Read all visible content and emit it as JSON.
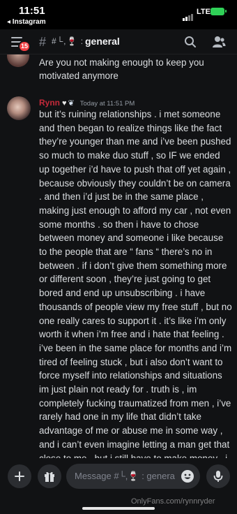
{
  "status_bar": {
    "time": "11:51",
    "back_app": "◂ Instagram",
    "network": "LTE"
  },
  "header": {
    "unread_badge": "15",
    "channel_icons": "#└,🍷 :",
    "channel_name": "general"
  },
  "messages": [
    {
      "text": "Are you not making enough to keep you motivated anymore"
    },
    {
      "author": "Rynn",
      "author_color": "#c4293a",
      "timestamp": "Today at 11:51 PM",
      "text": "but it’s ruining relationships . i met someone and then began to realize things like the fact they’re younger than me and i’ve been pushed so much to make duo stuff , so IF we ended up together i’d have to push that off yet again , because obviously they couldn’t be on camera . and then i’d just be in the same place , making just enough to afford my car , not even some months . so then i have to chose between money and someone i like because to the people that are “ fans “ there’s no in between . if i don’t give them something more or different soon , they’re just going to get bored and end up unsubscribing . i have thousands of people view my free stuff , but no one really cares to support it . it’s like i’m only worth it when i’m free and i hate that feeling . i’ve been in the same place for months and i’m tired of feeling stuck , but i also don’t want to force myself into relationships and situations im just plain not ready for . truth is , im completely fucking traumatized from men , i’ve rarely had one in my life that didn’t take advantage of me or abuse me in some way , and i can’t even imagine letting a man get that close to me , but i still have to make money . i have applied"
    }
  ],
  "composer": {
    "placeholder": "Message #└,🍷 : genera"
  },
  "watermark": "OnlyFans.com/rynnryder",
  "colors": {
    "background": "#111214",
    "badge": "#f23f43",
    "battery": "#30d158"
  }
}
